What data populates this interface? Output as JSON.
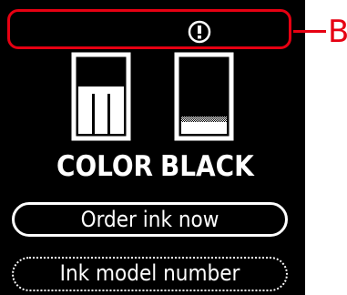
{
  "callout": {
    "label": "B",
    "color": "#e60012"
  },
  "status": {
    "icon": "alert-icon"
  },
  "ink": {
    "color": {
      "label": "COLOR",
      "level": 0.6,
      "icon": "color-ink-cartridge-icon"
    },
    "black": {
      "label": "BLACK",
      "level": 0.15,
      "icon": "black-ink-cartridge-icon"
    }
  },
  "menu": {
    "order_label": "Order ink now",
    "model_label": "Ink model number"
  }
}
